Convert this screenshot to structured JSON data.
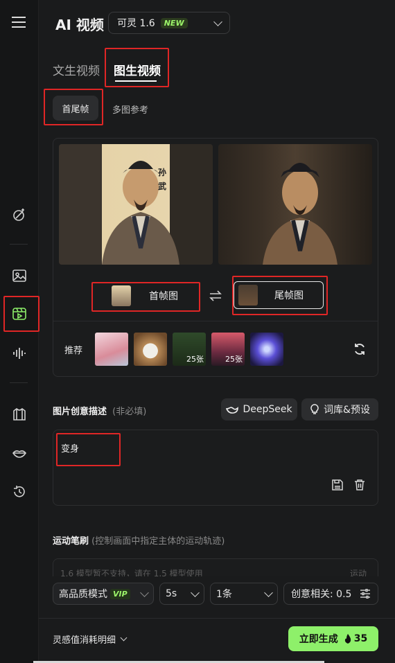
{
  "header": {
    "title": "AI 视频",
    "model_label": "可灵 1.6",
    "model_badge": "NEW"
  },
  "tabs": {
    "text_video": "文生视频",
    "image_video": "图生视频"
  },
  "subtabs": {
    "first_last": "首尾帧",
    "multi_ref": "多图参考"
  },
  "frames": {
    "first_caption_chars": [
      "孙",
      "武"
    ],
    "first_button": "首帧图",
    "last_button": "尾帧图"
  },
  "recommend": {
    "label": "推荐",
    "thumbs": [
      {
        "name": "pink-landscape",
        "count": ""
      },
      {
        "name": "puppy",
        "count": ""
      },
      {
        "name": "forest",
        "count": "25张"
      },
      {
        "name": "sunset-road",
        "count": "25张"
      },
      {
        "name": "purple-creature",
        "count": ""
      }
    ]
  },
  "prompt": {
    "label": "图片创意描述",
    "optional": "(非必填)",
    "deepseek": "DeepSeek",
    "library": "词库&预设",
    "value": "变身"
  },
  "motion": {
    "label": "运动笔刷",
    "hint": "(控制画面中指定主体的运动轨迹)",
    "notice": "1.6 模型暂不支持，请在 1.5 模型使用",
    "notice_right": "运动"
  },
  "settings": {
    "quality": "高品质模式",
    "vip": "VIP",
    "duration": "5s",
    "count": "1条",
    "creativity": "创意相关: 0.5"
  },
  "footer": {
    "cost_detail": "灵感值消耗明细",
    "generate": "立即生成",
    "credits": "35"
  },
  "colors": {
    "accent_green": "#8ef06a",
    "highlight_red": "#e02626",
    "background": "#1a1b1c"
  }
}
